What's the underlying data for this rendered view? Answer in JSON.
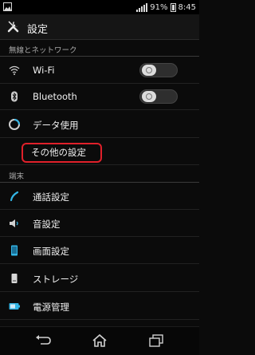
{
  "status_bar": {
    "battery_percent": "91%",
    "time": "8:45"
  },
  "header": {
    "title": "設定",
    "icon": "wrench-icon"
  },
  "sections": {
    "wireless_header": "無線とネットワーク",
    "device_header": "端末"
  },
  "wireless_items": [
    {
      "label": "Wi-Fi",
      "icon": "wifi-icon",
      "toggle_on": false
    },
    {
      "label": "Bluetooth",
      "icon": "bluetooth-icon",
      "toggle_on": false
    },
    {
      "label": "データ使用",
      "icon": "data-usage-icon"
    },
    {
      "label": "その他の設定",
      "icon": ""
    }
  ],
  "device_items": [
    {
      "label": "通話設定",
      "icon": "phone-icon"
    },
    {
      "label": "音設定",
      "icon": "volume-icon"
    },
    {
      "label": "画面設定",
      "icon": "display-icon"
    },
    {
      "label": "ストレージ",
      "icon": "storage-icon"
    },
    {
      "label": "電源管理",
      "icon": "battery-icon"
    }
  ],
  "colors": {
    "highlight": "#e0202a",
    "accent_blue": "#33b5e5"
  }
}
